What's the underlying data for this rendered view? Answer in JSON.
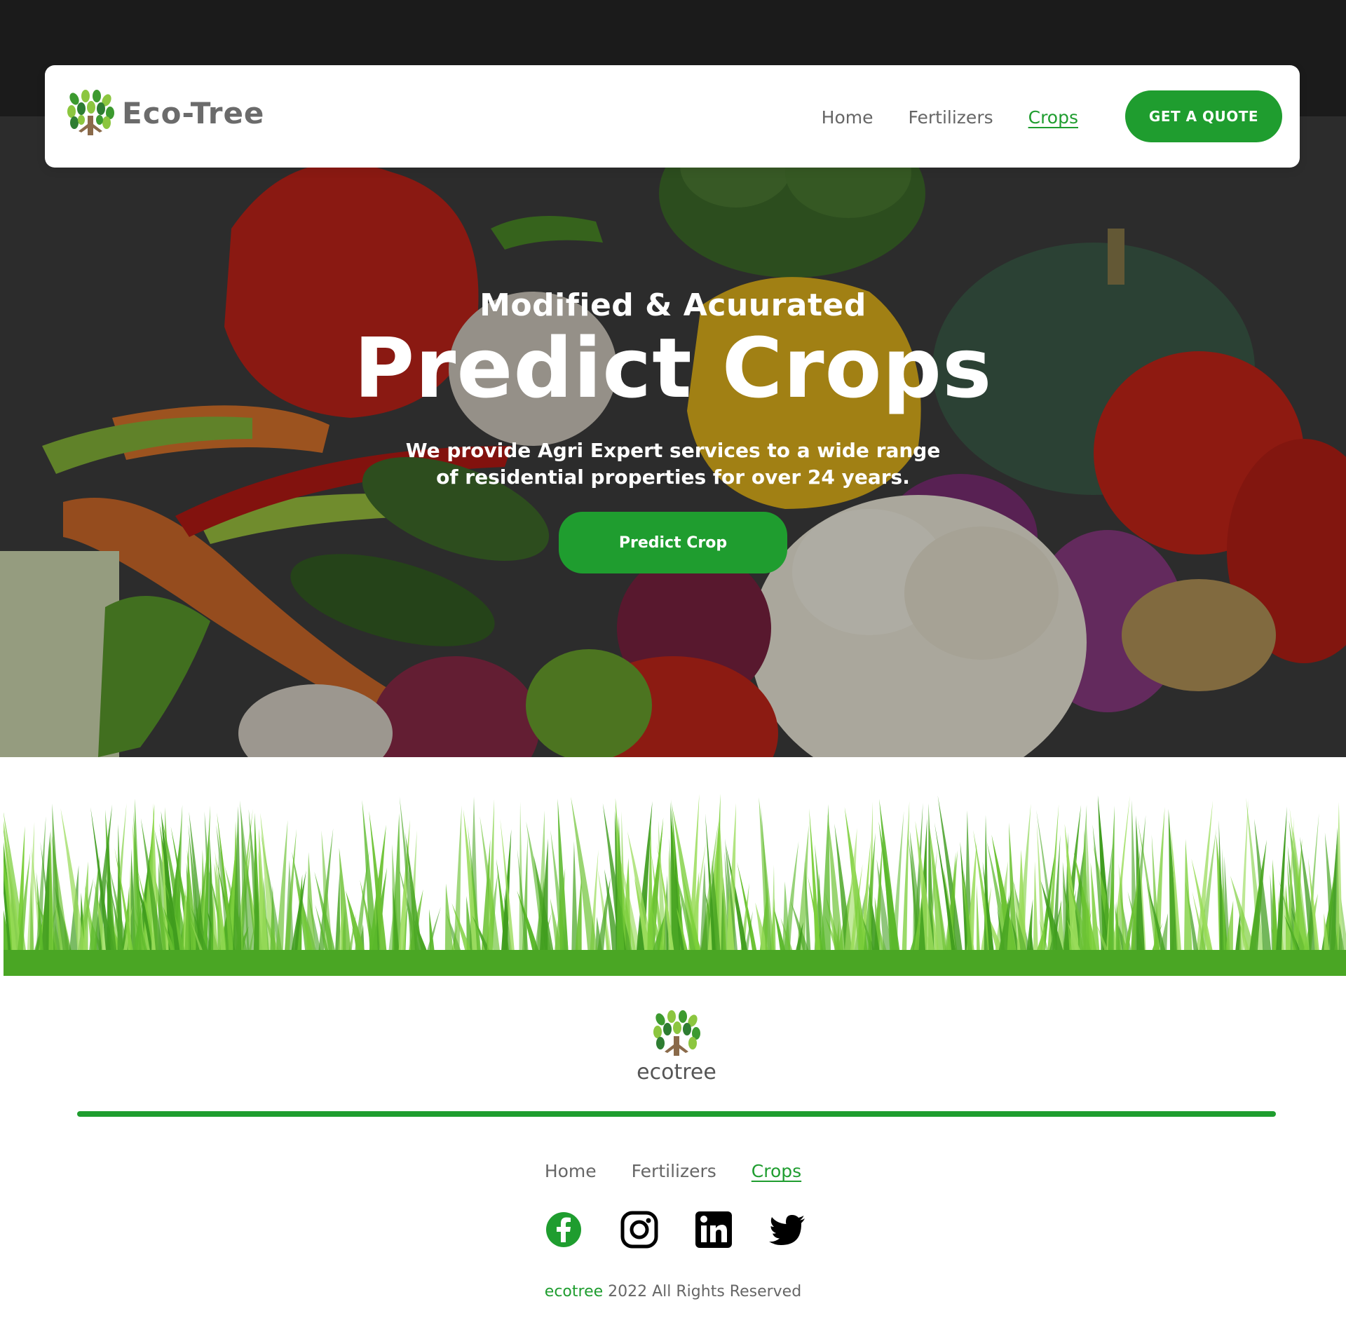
{
  "colors": {
    "accent": "#1f9d2f",
    "text_muted": "#666666",
    "hero_text": "#ffffff"
  },
  "nav": {
    "brand": "Eco-Tree",
    "logo_icon": "tree-logo-icon",
    "links": [
      {
        "label": "Home",
        "active": false
      },
      {
        "label": "Fertilizers",
        "active": false
      },
      {
        "label": "Crops",
        "active": true
      }
    ],
    "cta_label": "GET A QUOTE"
  },
  "hero": {
    "kicker": "Modified & Acuurated",
    "title": "Predict Crops",
    "subtitle": "We provide Agri Expert services to a wide range of residential properties for over 24 years.",
    "button_label": "Predict Crop",
    "background": "vegetables-photo"
  },
  "decor": {
    "grass": "grass-banner"
  },
  "footer": {
    "brand": "ecotree",
    "logo_icon": "tree-logo-icon",
    "links": [
      {
        "label": "Home",
        "active": false
      },
      {
        "label": "Fertilizers",
        "active": false
      },
      {
        "label": "Crops",
        "active": true
      }
    ],
    "socials": [
      "facebook-icon",
      "instagram-icon",
      "linkedin-icon",
      "twitter-icon"
    ],
    "copyright_brand": "ecotree",
    "copyright_text": " 2022 All Rights Reserved"
  }
}
